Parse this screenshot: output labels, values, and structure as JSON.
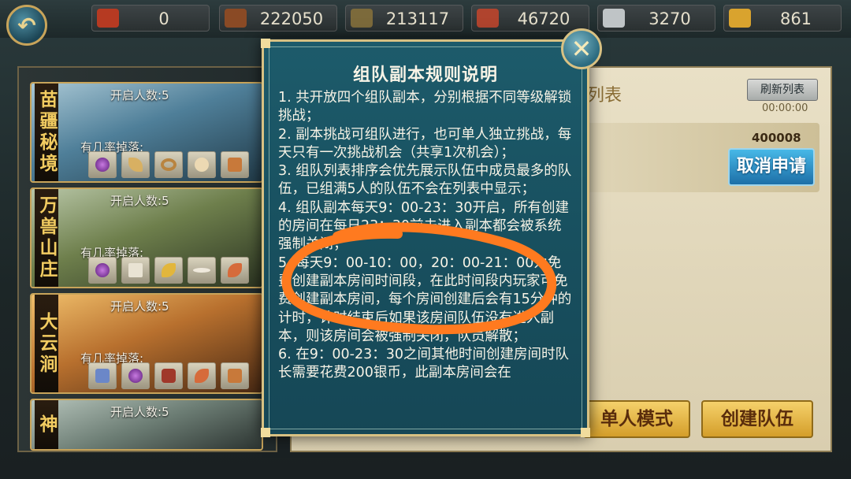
{
  "resources": [
    {
      "icon": "red-badge-icon",
      "value": "0",
      "color": "#b63a22"
    },
    {
      "icon": "wood-logs-icon",
      "value": "222050",
      "color": "#8a4a25"
    },
    {
      "icon": "stone-slab-icon",
      "value": "213117",
      "color": "#7c6a3b"
    },
    {
      "icon": "ore-icon",
      "value": "46720",
      "color": "#b0442e"
    },
    {
      "icon": "silver-ingot-icon",
      "value": "3270",
      "color": "#bfc4c6"
    },
    {
      "icon": "gold-ingot-icon",
      "value": "861",
      "color": "#d9a32e"
    }
  ],
  "dungeons": [
    {
      "name": "苗疆秘境",
      "count": "开启人数:5",
      "drop_label": "有几率掉落:",
      "theme": "#4f7f99",
      "items": [
        "purple-orb-icon",
        "fang-icon",
        "ring-icon",
        "shell-icon",
        "hide-icon"
      ]
    },
    {
      "name": "万兽山庄",
      "count": "开启人数:5",
      "drop_label": "有几率掉落:",
      "theme": "#6e7f4c",
      "items": [
        "purple-orb-icon",
        "claw-icon",
        "banana-icon",
        "bone-icon",
        "horn-icon"
      ]
    },
    {
      "name": "大云涧",
      "count": "开启人数:5",
      "drop_label": "有几率掉落:",
      "theme": "#b8702e",
      "items": [
        "scroll-icon",
        "purple-orb-icon",
        "meat-icon",
        "horn-icon",
        "hide-icon"
      ]
    },
    {
      "name": "神",
      "count": "开启人数:5",
      "drop_label": "",
      "theme": "#6c7d74",
      "items": []
    }
  ],
  "right": {
    "list_title": "列表",
    "refresh_label": "刷新列表",
    "timer": "00:00:00",
    "team_id": "400008",
    "cancel_label": "取消申请",
    "solo_label": "单人模式",
    "create_label": "创建队伍"
  },
  "modal": {
    "title": "组队副本规则说明",
    "rules": [
      "1. 共开放四个组队副本，分别根据不同等级解锁挑战；",
      "2. 副本挑战可组队进行，也可单人独立挑战，每天只有一次挑战机会（共享1次机会）；",
      "3. 组队列表排序会优先展示队伍中成员最多的队伍，已组满5人的队伍不会在列表中显示；",
      "4. 组队副本每天9：00-23：30开启，所有创建的房间在每日23：30前未进入副本都会被系统强制关闭；",
      "5. 每天9：00-10：00，20：00-21：00为免费创建副本房间时间段，在此时间段内玩家可免费创建副本房间，每个房间创建后会有15分钟的计时，计时结束后如果该房间队伍没有进入副本，则该房间会被强制关闭，队员解散；",
      "6. 在9：00-23：30之间其他时间创建房间时队长需要花费200银币，此副本房间会在"
    ],
    "close_icon": "close-icon"
  },
  "colors": {
    "accent_gold": "#d8c183",
    "modal_bg": "#1b5565",
    "scribble": "#ff7a1f"
  }
}
